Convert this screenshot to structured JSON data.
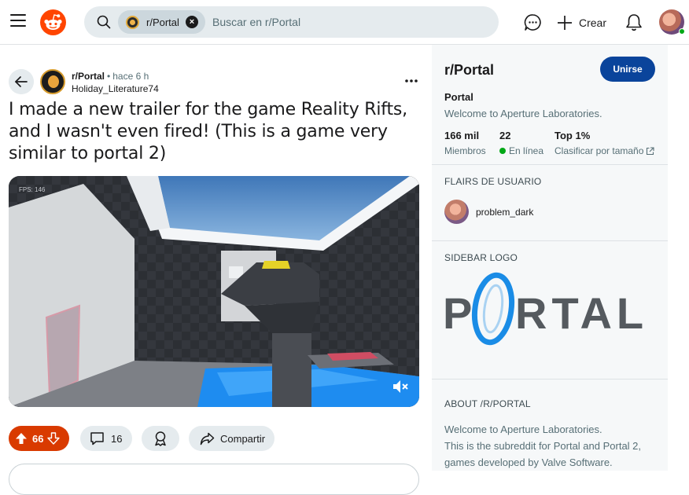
{
  "header": {
    "search_chip_label": "r/Portal",
    "search_chip_close": "×",
    "search_placeholder": "Buscar en r/Portal",
    "create_label": "Crear"
  },
  "post": {
    "subreddit": "r/Portal",
    "separator": "•",
    "time": "hace 6 h",
    "author": "Holiday_Literature74",
    "title": "I made a new trailer for the game Reality Rifts, and I wasn't even fired! (This is a game very similar to portal 2)",
    "video_overlay_text": "FPS: 146",
    "upvotes": "66",
    "comments": "16",
    "share_label": "Compartir"
  },
  "sidebar": {
    "title": "r/Portal",
    "join_label": "Unirse",
    "name": "Portal",
    "description": "Welcome to Aperture Laboratories.",
    "stats": [
      {
        "value": "166 mil",
        "label": "Miembros"
      },
      {
        "value": "22",
        "label": "En línea"
      },
      {
        "value": "Top 1%",
        "label": "Clasificar por tamaño"
      }
    ],
    "flairs_heading": "FLAIRS DE USUARIO",
    "flair_user": "problem_dark",
    "logo_heading": "SIDEBAR LOGO",
    "logo_text_left": "P",
    "logo_text_right": "RTAL",
    "about_heading": "ABOUT /R/PORTAL",
    "about_lines": [
      "Welcome to Aperture Laboratories.",
      "This is the subreddit for Portal and Portal 2,",
      "games developed by Valve Software."
    ]
  },
  "colors": {
    "brand_orange": "#ff4500",
    "upvote_bg": "#d93a00",
    "join_bg": "#0a449b",
    "online_green": "#01a816",
    "portal_blue": "#1a8ce6",
    "portal_gray": "#555a5f"
  },
  "icons": [
    "menu-icon",
    "reddit-logo",
    "search-icon",
    "chat-icon",
    "plus-icon",
    "bell-icon",
    "back-arrow-icon",
    "more-icon",
    "mute-icon",
    "upvote-icon",
    "downvote-icon",
    "comment-icon",
    "award-icon",
    "share-icon",
    "external-link-icon"
  ]
}
